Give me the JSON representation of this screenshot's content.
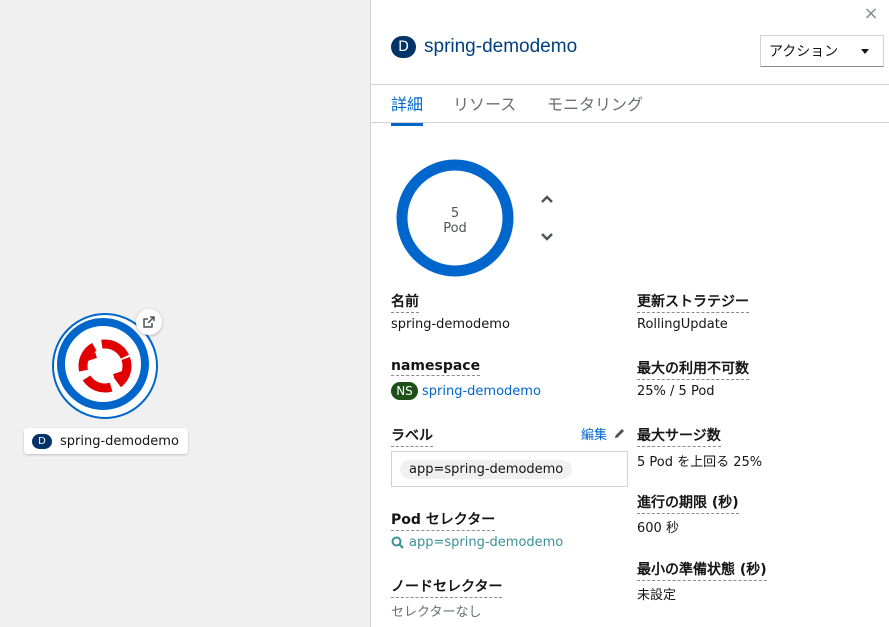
{
  "topology": {
    "node_badge": "D",
    "node_label": "spring-demodemo"
  },
  "panel": {
    "close_label": "×",
    "badge": "D",
    "title": "spring-demodemo",
    "actions_label": "アクション",
    "tabs": [
      "詳細",
      "リソース",
      "モニタリング"
    ],
    "active_tab": "詳細",
    "pod_count": "5",
    "pod_label": "Pod",
    "pod_ring_fill": 1.0,
    "details": {
      "name_title": "名前",
      "name_value": "spring-demodemo",
      "namespace_title": "namespace",
      "namespace_badge": "NS",
      "namespace_value": "spring-demodemo",
      "labels_title": "ラベル",
      "edit_label": "編集",
      "label_chip": "app=spring-demodemo",
      "pod_selector_title": "Pod セレクター",
      "pod_selector_value": "app=spring-demodemo",
      "node_selector_title": "ノードセレクター",
      "node_selector_value": "セレクターなし",
      "update_strategy_title": "更新ストラテジー",
      "update_strategy_value": "RollingUpdate",
      "max_unavailable_title": "最大の利用不可数",
      "max_unavailable_value": "25% / 5 Pod",
      "max_surge_title": "最大サージ数",
      "max_surge_value": "5 Pod を上回る 25%",
      "progress_deadline_title": "進行の期限 (秒)",
      "progress_deadline_value": "600 秒",
      "min_ready_title": "最小の準備状態 (秒)",
      "min_ready_value": "未設定"
    }
  },
  "colors": {
    "accent": "#0066cc",
    "deployment_badge": "#003366",
    "namespace_badge": "#1e4f18",
    "openshift_red": "#e00000"
  }
}
